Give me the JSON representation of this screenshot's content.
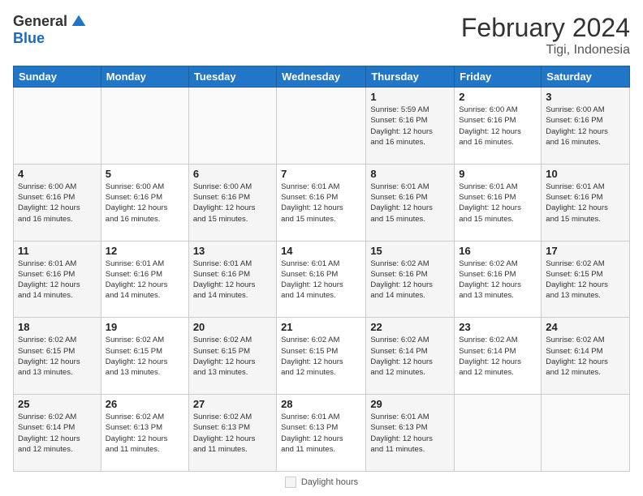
{
  "logo": {
    "general": "General",
    "blue": "Blue"
  },
  "header": {
    "title": "February 2024",
    "subtitle": "Tigi, Indonesia"
  },
  "weekdays": [
    "Sunday",
    "Monday",
    "Tuesday",
    "Wednesday",
    "Thursday",
    "Friday",
    "Saturday"
  ],
  "footer": {
    "label": "Daylight hours"
  },
  "weeks": [
    [
      {
        "day": "",
        "info": ""
      },
      {
        "day": "",
        "info": ""
      },
      {
        "day": "",
        "info": ""
      },
      {
        "day": "",
        "info": ""
      },
      {
        "day": "1",
        "info": "Sunrise: 5:59 AM\nSunset: 6:16 PM\nDaylight: 12 hours\nand 16 minutes."
      },
      {
        "day": "2",
        "info": "Sunrise: 6:00 AM\nSunset: 6:16 PM\nDaylight: 12 hours\nand 16 minutes."
      },
      {
        "day": "3",
        "info": "Sunrise: 6:00 AM\nSunset: 6:16 PM\nDaylight: 12 hours\nand 16 minutes."
      }
    ],
    [
      {
        "day": "4",
        "info": "Sunrise: 6:00 AM\nSunset: 6:16 PM\nDaylight: 12 hours\nand 16 minutes."
      },
      {
        "day": "5",
        "info": "Sunrise: 6:00 AM\nSunset: 6:16 PM\nDaylight: 12 hours\nand 16 minutes."
      },
      {
        "day": "6",
        "info": "Sunrise: 6:00 AM\nSunset: 6:16 PM\nDaylight: 12 hours\nand 15 minutes."
      },
      {
        "day": "7",
        "info": "Sunrise: 6:01 AM\nSunset: 6:16 PM\nDaylight: 12 hours\nand 15 minutes."
      },
      {
        "day": "8",
        "info": "Sunrise: 6:01 AM\nSunset: 6:16 PM\nDaylight: 12 hours\nand 15 minutes."
      },
      {
        "day": "9",
        "info": "Sunrise: 6:01 AM\nSunset: 6:16 PM\nDaylight: 12 hours\nand 15 minutes."
      },
      {
        "day": "10",
        "info": "Sunrise: 6:01 AM\nSunset: 6:16 PM\nDaylight: 12 hours\nand 15 minutes."
      }
    ],
    [
      {
        "day": "11",
        "info": "Sunrise: 6:01 AM\nSunset: 6:16 PM\nDaylight: 12 hours\nand 14 minutes."
      },
      {
        "day": "12",
        "info": "Sunrise: 6:01 AM\nSunset: 6:16 PM\nDaylight: 12 hours\nand 14 minutes."
      },
      {
        "day": "13",
        "info": "Sunrise: 6:01 AM\nSunset: 6:16 PM\nDaylight: 12 hours\nand 14 minutes."
      },
      {
        "day": "14",
        "info": "Sunrise: 6:01 AM\nSunset: 6:16 PM\nDaylight: 12 hours\nand 14 minutes."
      },
      {
        "day": "15",
        "info": "Sunrise: 6:02 AM\nSunset: 6:16 PM\nDaylight: 12 hours\nand 14 minutes."
      },
      {
        "day": "16",
        "info": "Sunrise: 6:02 AM\nSunset: 6:16 PM\nDaylight: 12 hours\nand 13 minutes."
      },
      {
        "day": "17",
        "info": "Sunrise: 6:02 AM\nSunset: 6:15 PM\nDaylight: 12 hours\nand 13 minutes."
      }
    ],
    [
      {
        "day": "18",
        "info": "Sunrise: 6:02 AM\nSunset: 6:15 PM\nDaylight: 12 hours\nand 13 minutes."
      },
      {
        "day": "19",
        "info": "Sunrise: 6:02 AM\nSunset: 6:15 PM\nDaylight: 12 hours\nand 13 minutes."
      },
      {
        "day": "20",
        "info": "Sunrise: 6:02 AM\nSunset: 6:15 PM\nDaylight: 12 hours\nand 13 minutes."
      },
      {
        "day": "21",
        "info": "Sunrise: 6:02 AM\nSunset: 6:15 PM\nDaylight: 12 hours\nand 12 minutes."
      },
      {
        "day": "22",
        "info": "Sunrise: 6:02 AM\nSunset: 6:14 PM\nDaylight: 12 hours\nand 12 minutes."
      },
      {
        "day": "23",
        "info": "Sunrise: 6:02 AM\nSunset: 6:14 PM\nDaylight: 12 hours\nand 12 minutes."
      },
      {
        "day": "24",
        "info": "Sunrise: 6:02 AM\nSunset: 6:14 PM\nDaylight: 12 hours\nand 12 minutes."
      }
    ],
    [
      {
        "day": "25",
        "info": "Sunrise: 6:02 AM\nSunset: 6:14 PM\nDaylight: 12 hours\nand 12 minutes."
      },
      {
        "day": "26",
        "info": "Sunrise: 6:02 AM\nSunset: 6:13 PM\nDaylight: 12 hours\nand 11 minutes."
      },
      {
        "day": "27",
        "info": "Sunrise: 6:02 AM\nSunset: 6:13 PM\nDaylight: 12 hours\nand 11 minutes."
      },
      {
        "day": "28",
        "info": "Sunrise: 6:01 AM\nSunset: 6:13 PM\nDaylight: 12 hours\nand 11 minutes."
      },
      {
        "day": "29",
        "info": "Sunrise: 6:01 AM\nSunset: 6:13 PM\nDaylight: 12 hours\nand 11 minutes."
      },
      {
        "day": "",
        "info": ""
      },
      {
        "day": "",
        "info": ""
      }
    ]
  ]
}
